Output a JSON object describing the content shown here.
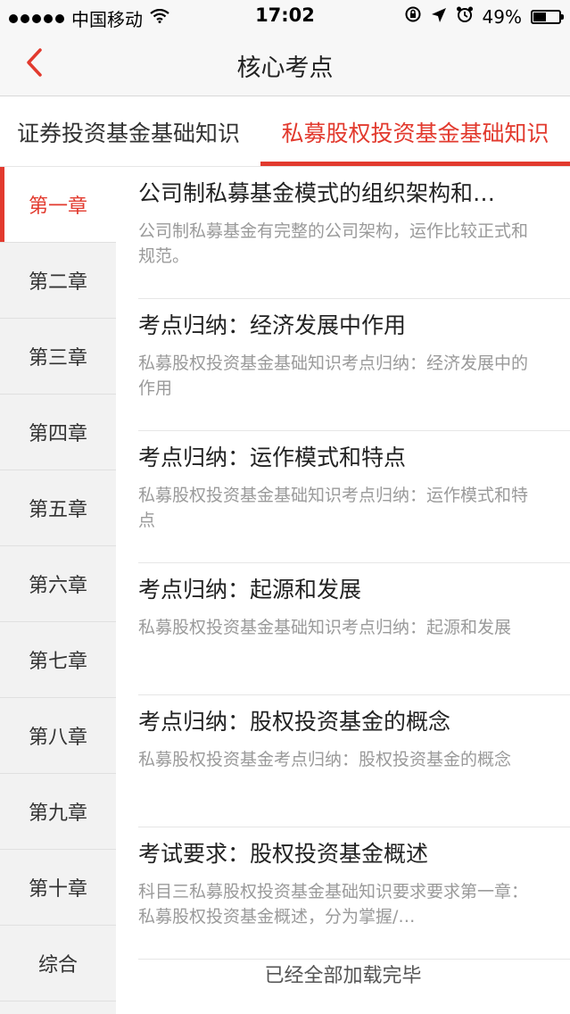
{
  "status_bar": {
    "carrier": "中国移动",
    "time": "17:02",
    "battery": "49%",
    "battery_level": 0.49,
    "icons": [
      "signal-dots-icon",
      "wifi-icon",
      "rotation-lock-icon",
      "location-arrow-icon",
      "alarm-icon",
      "battery-icon"
    ]
  },
  "nav": {
    "title": "核心考点",
    "back_icon": "chevron-left-icon",
    "accent": "#e23a2e"
  },
  "tabs": [
    {
      "label": "证券投资基金基础知识",
      "active": false
    },
    {
      "label": "私募股权投资基金基础知识",
      "active": true
    }
  ],
  "sidebar": {
    "items": [
      {
        "label": "第一章",
        "active": true
      },
      {
        "label": "第二章"
      },
      {
        "label": "第三章"
      },
      {
        "label": "第四章"
      },
      {
        "label": "第五章"
      },
      {
        "label": "第六章"
      },
      {
        "label": "第七章"
      },
      {
        "label": "第八章"
      },
      {
        "label": "第九章"
      },
      {
        "label": "第十章"
      },
      {
        "label": "综合"
      }
    ]
  },
  "list": {
    "items": [
      {
        "title": "公司制私募基金模式的组织架构和…",
        "desc": "公司制私募基金有完整的公司架构，运作比较正式和规范。"
      },
      {
        "title": "考点归纳：经济发展中作用",
        "desc": "私募股权投资基金基础知识考点归纳：经济发展中的作用"
      },
      {
        "title": "考点归纳：运作模式和特点",
        "desc": "私募股权投资基金基础知识考点归纳：运作模式和特点"
      },
      {
        "title": "考点归纳：起源和发展",
        "desc": "私募股权投资基金基础知识考点归纳：起源和发展"
      },
      {
        "title": "考点归纳：股权投资基金的概念",
        "desc": "私募股权投资基金考点归纳：股权投资基金的概念"
      },
      {
        "title": "考试要求：股权投资基金概述",
        "desc": "科目三私募股权投资基金基础知识要求要求第一章：私募股权投资基金概述，分为掌握/…"
      }
    ],
    "footer": "已经全部加载完毕"
  }
}
